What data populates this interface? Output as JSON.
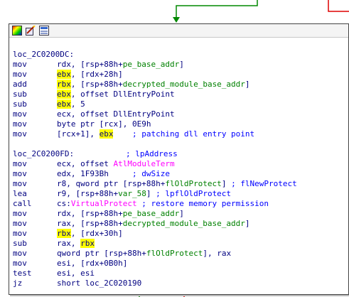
{
  "colors": {
    "edge_green": "#008800",
    "edge_red": "#dd0000",
    "text": "#000080",
    "symbol": "#008000",
    "import": "#ff00ff",
    "comment": "#0000ff",
    "highlight": "#ffff00"
  },
  "toolbar": {
    "icons": [
      "color-palette-icon",
      "edit-node-icon",
      "group-nodes-icon"
    ]
  },
  "code": [
    {
      "type": "label",
      "segments": [
        {
          "t": "loc_2C0200DC:",
          "c": "plain"
        }
      ]
    },
    {
      "type": "insn",
      "mnem": "mov",
      "segments": [
        {
          "t": "rdx",
          "c": "reg"
        },
        {
          "t": ", [rsp+88h+",
          "c": "plain"
        },
        {
          "t": "pe_base_addr",
          "c": "sym"
        },
        {
          "t": "]",
          "c": "plain"
        }
      ]
    },
    {
      "type": "insn",
      "mnem": "mov",
      "segments": [
        {
          "t": "ebx",
          "c": "hl"
        },
        {
          "t": ", [rdx+28h]",
          "c": "plain"
        }
      ]
    },
    {
      "type": "insn",
      "mnem": "add",
      "segments": [
        {
          "t": "rbx",
          "c": "hl"
        },
        {
          "t": ", [rsp+88h+",
          "c": "plain"
        },
        {
          "t": "decrypted_module_base_addr",
          "c": "sym"
        },
        {
          "t": "]",
          "c": "plain"
        }
      ]
    },
    {
      "type": "insn",
      "mnem": "sub",
      "segments": [
        {
          "t": "ebx",
          "c": "hl"
        },
        {
          "t": ", offset DllEntryPoint",
          "c": "plain"
        }
      ]
    },
    {
      "type": "insn",
      "mnem": "sub",
      "segments": [
        {
          "t": "ebx",
          "c": "hl"
        },
        {
          "t": ", 5",
          "c": "plain"
        }
      ]
    },
    {
      "type": "insn",
      "mnem": "mov",
      "segments": [
        {
          "t": "ecx, offset DllEntryPoint",
          "c": "plain"
        }
      ]
    },
    {
      "type": "insn",
      "mnem": "mov",
      "segments": [
        {
          "t": "byte ptr [rcx], 0E9h",
          "c": "plain"
        }
      ]
    },
    {
      "type": "insn",
      "mnem": "mov",
      "segments": [
        {
          "t": "[rcx+1], ",
          "c": "plain"
        },
        {
          "t": "ebx",
          "c": "hl"
        },
        {
          "t": "    ",
          "c": "plain"
        },
        {
          "t": "; patching dll entry point",
          "c": "cmt"
        }
      ]
    },
    {
      "type": "blank",
      "segments": []
    },
    {
      "type": "label",
      "segments": [
        {
          "t": "loc_2C0200FD:",
          "c": "plain"
        },
        {
          "t": "           ",
          "c": "plain"
        },
        {
          "t": "; lpAddress",
          "c": "cmt"
        }
      ]
    },
    {
      "type": "insn",
      "mnem": "mov",
      "segments": [
        {
          "t": "ecx, offset ",
          "c": "plain"
        },
        {
          "t": "AtlModuleTerm",
          "c": "imp"
        }
      ]
    },
    {
      "type": "insn",
      "mnem": "mov",
      "segments": [
        {
          "t": "edx, 1F93Bh     ",
          "c": "plain"
        },
        {
          "t": "; dwSize",
          "c": "cmt"
        }
      ]
    },
    {
      "type": "insn",
      "mnem": "mov",
      "segments": [
        {
          "t": "r8, qword ptr [rsp+88h+",
          "c": "plain"
        },
        {
          "t": "flOldProtect",
          "c": "sym"
        },
        {
          "t": "] ",
          "c": "plain"
        },
        {
          "t": "; flNewProtect",
          "c": "cmt"
        }
      ]
    },
    {
      "type": "insn",
      "mnem": "lea",
      "segments": [
        {
          "t": "r9, [rsp+88h+",
          "c": "plain"
        },
        {
          "t": "var_58",
          "c": "sym"
        },
        {
          "t": "] ",
          "c": "plain"
        },
        {
          "t": "; lpflOldProtect",
          "c": "cmt"
        }
      ]
    },
    {
      "type": "insn",
      "mnem": "call",
      "segments": [
        {
          "t": "cs:",
          "c": "plain"
        },
        {
          "t": "VirtualProtect",
          "c": "imp"
        },
        {
          "t": " ",
          "c": "plain"
        },
        {
          "t": "; restore memory permission",
          "c": "cmt"
        }
      ]
    },
    {
      "type": "insn",
      "mnem": "mov",
      "segments": [
        {
          "t": "rdx, [rsp+88h+",
          "c": "plain"
        },
        {
          "t": "pe_base_addr",
          "c": "sym"
        },
        {
          "t": "]",
          "c": "plain"
        }
      ]
    },
    {
      "type": "insn",
      "mnem": "mov",
      "segments": [
        {
          "t": "rax, [rsp+88h+",
          "c": "plain"
        },
        {
          "t": "decrypted_module_base_addr",
          "c": "sym"
        },
        {
          "t": "]",
          "c": "plain"
        }
      ]
    },
    {
      "type": "insn",
      "mnem": "mov",
      "segments": [
        {
          "t": "rbx",
          "c": "hl"
        },
        {
          "t": ", [rdx+30h]",
          "c": "plain"
        }
      ]
    },
    {
      "type": "insn",
      "mnem": "sub",
      "segments": [
        {
          "t": "rax, ",
          "c": "plain"
        },
        {
          "t": "rbx",
          "c": "hl"
        }
      ]
    },
    {
      "type": "insn",
      "mnem": "mov",
      "segments": [
        {
          "t": "qword ptr [rsp+88h+",
          "c": "plain"
        },
        {
          "t": "flOldProtect",
          "c": "sym"
        },
        {
          "t": "], rax",
          "c": "plain"
        }
      ]
    },
    {
      "type": "insn",
      "mnem": "mov",
      "segments": [
        {
          "t": "esi, [rdx+0B0h]",
          "c": "plain"
        }
      ]
    },
    {
      "type": "insn",
      "mnem": "test",
      "segments": [
        {
          "t": "esi, esi",
          "c": "plain"
        }
      ]
    },
    {
      "type": "insn",
      "mnem": "jz",
      "segments": [
        {
          "t": "short loc_2C020190",
          "c": "plain"
        }
      ]
    }
  ]
}
